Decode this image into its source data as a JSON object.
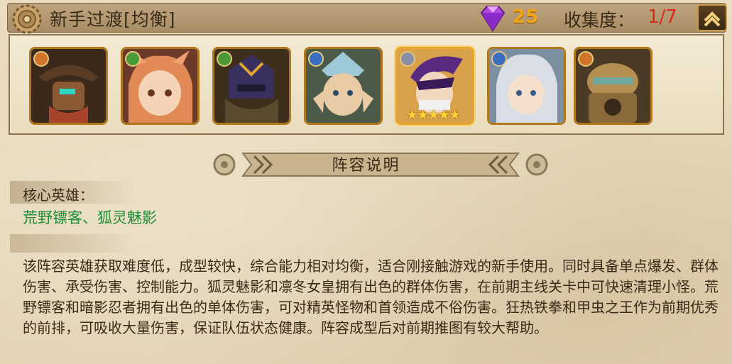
{
  "header": {
    "title": "新手过渡[均衡]",
    "gem_count": "25",
    "collect_label": "收集度：",
    "collect_value": "1/7"
  },
  "heroes": [
    {
      "name": "hero-1",
      "faction": "tech",
      "selected": false
    },
    {
      "name": "hero-2",
      "faction": "nature",
      "selected": false
    },
    {
      "name": "hero-3",
      "faction": "nature",
      "selected": false
    },
    {
      "name": "hero-4",
      "faction": "water",
      "selected": false
    },
    {
      "name": "hero-5",
      "faction": "shadow",
      "selected": true,
      "stars": "★★★★★"
    },
    {
      "name": "hero-6",
      "faction": "water",
      "selected": false
    },
    {
      "name": "hero-7",
      "faction": "tech",
      "selected": false
    }
  ],
  "section": {
    "title": "阵容说明",
    "core_label": "核心英雄：",
    "core_heroes": "荒野镖客、狐灵魅影",
    "description": "该阵容英雄获取难度低，成型较快，综合能力相对均衡，适合刚接触游戏的新手使用。同时具备单点爆发、群体伤害、承受伤害、控制能力。狐灵魅影和凛冬女皇拥有出色的群体伤害，在前期主线关卡中可快速清理小怪。荒野镖客和暗影忍者拥有出色的单体伤害，可对精英怪物和首领造成不俗伤害。狂热铁拳和甲虫之王作为前期优秀的前排，可吸收大量伤害，保证队伍状态健康。阵容成型后对前期推图有较大帮助。"
  },
  "colors": {
    "accent_gold": "#f2a516",
    "collect_red": "#d62a1d",
    "core_green": "#1e8c35"
  }
}
